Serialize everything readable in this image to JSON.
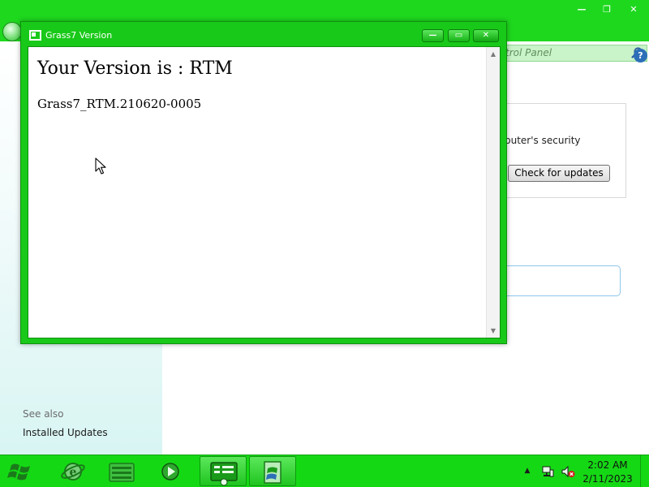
{
  "colors": {
    "window_frame": "#19c919",
    "taskbar": "#15d815",
    "titlebar_bg": "#1ed81e",
    "content_bg": "#ffffff",
    "link_blue": "#2c6fb8"
  },
  "background_window": {
    "search_placeholder": "trol Panel",
    "search_icon": "magnifier-icon",
    "controls": {
      "minimize": "—",
      "maximize": "❐",
      "close": "✕"
    },
    "help_label": "?",
    "security_text": "puter's security",
    "check_updates_label": "Check for updates",
    "sidebar": {
      "see_also_label": "See also",
      "installed_updates_label": "Installed Updates"
    }
  },
  "dialog": {
    "title": "Grass7 Version",
    "heading": "Your Version is : RTM",
    "build": "Grass7_RTM.210620-0005",
    "controls": {
      "minimize": "—",
      "maximize": "▭",
      "close": "✕"
    },
    "scroll_up": "▲",
    "scroll_down": "▼"
  },
  "taskbar": {
    "items": [
      {
        "name": "internet-explorer",
        "icon": "ie-icon",
        "active": false
      },
      {
        "name": "windows-explorer",
        "icon": "folder-icon",
        "active": false
      },
      {
        "name": "media-player",
        "icon": "media-player-icon",
        "active": false
      },
      {
        "name": "control-panel",
        "icon": "control-panel-icon",
        "active": true
      },
      {
        "name": "grass7-version",
        "icon": "winver-icon",
        "active": true
      }
    ],
    "tray": {
      "show_hidden_label": "▲",
      "network_icon": "network-icon",
      "volume_icon": "volume-muted-icon"
    },
    "clock": {
      "time": "2:02 AM",
      "date": "2/11/2023"
    }
  }
}
